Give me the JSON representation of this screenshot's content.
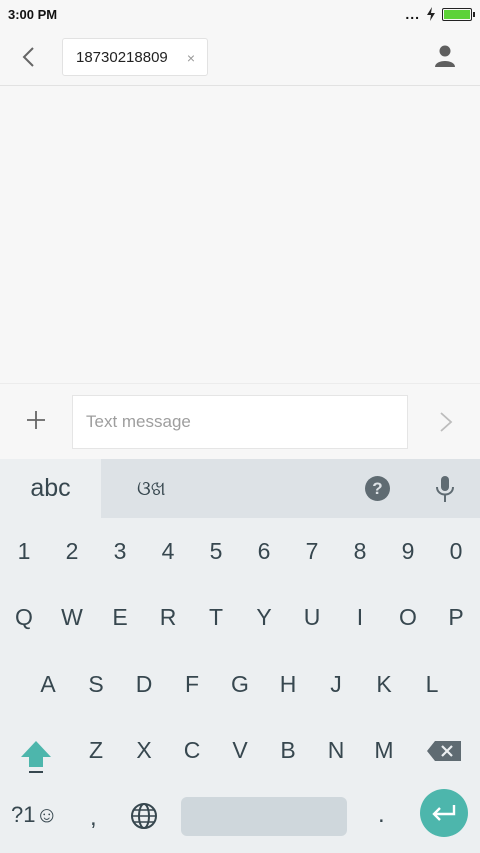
{
  "status": {
    "time": "3:00 PM",
    "dots": "...",
    "battery_level": 1.0,
    "battery_color": "#5cd238"
  },
  "header": {
    "recipient": "18730218809",
    "remove_symbol": "×"
  },
  "composer": {
    "placeholder": "Text message"
  },
  "keyboard": {
    "mode_label": "abc",
    "script_label": "ଓଖ",
    "help_label": "?",
    "numbers": [
      "1",
      "2",
      "3",
      "4",
      "5",
      "6",
      "7",
      "8",
      "9",
      "0"
    ],
    "row1": [
      "Q",
      "W",
      "E",
      "R",
      "T",
      "Y",
      "U",
      "I",
      "O",
      "P"
    ],
    "row2": [
      "A",
      "S",
      "D",
      "F",
      "G",
      "H",
      "J",
      "K",
      "L"
    ],
    "row3": [
      "Z",
      "X",
      "C",
      "V",
      "B",
      "N",
      "M"
    ],
    "symbols_label": "?1☺",
    "comma": ",",
    "period": ".",
    "accent": "#4db6ac"
  }
}
